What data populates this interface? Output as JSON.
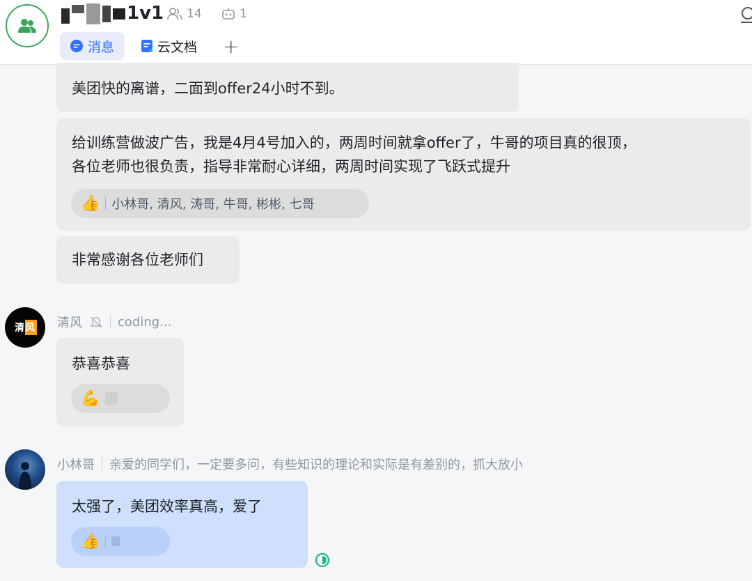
{
  "header": {
    "title": "1v1",
    "member_count": "14",
    "bot_count": "1",
    "tabs": [
      {
        "label": "消息",
        "icon": "chat-bubble-icon",
        "active": true
      },
      {
        "label": "云文档",
        "icon": "doc-icon",
        "active": false
      }
    ],
    "add_tab_label": "+"
  },
  "messages": {
    "m1": {
      "text": "美团快的离谱，二面到offer24小时不到。"
    },
    "m2": {
      "line1": "给训练营做波广告，我是4月4号加入的，两周时间就拿offer了，牛哥的项目真的很顶，",
      "line2": "各位老师也很负责，指导非常耐心详细，两周时间实现了飞跃式提升",
      "reaction_emoji": "👍",
      "reaction_users": "小林哥, 清风, 涛哥, 牛哥, 彬彬, 七哥"
    },
    "m3": {
      "text": "非常感谢各位老师们"
    },
    "qingfeng": {
      "sender": "清风",
      "status": "coding...",
      "avatar_text": "清风",
      "text": "恭喜恭喜",
      "reaction_emoji": "💪"
    },
    "xiaolin": {
      "sender": "小林哥",
      "signature": "亲爱的同学们，一定要多问，有些知识的理论和实际是有差别的，抓大放小",
      "text": "太强了，美团效率真高，爱了",
      "reaction_emoji": "👍"
    }
  },
  "colors": {
    "accent": "#3370ff",
    "group_green": "#3aa65b",
    "bubble_gray": "#ebebeb",
    "bubble_blue": "#cfe0fd",
    "read_green": "#1fb48a"
  }
}
